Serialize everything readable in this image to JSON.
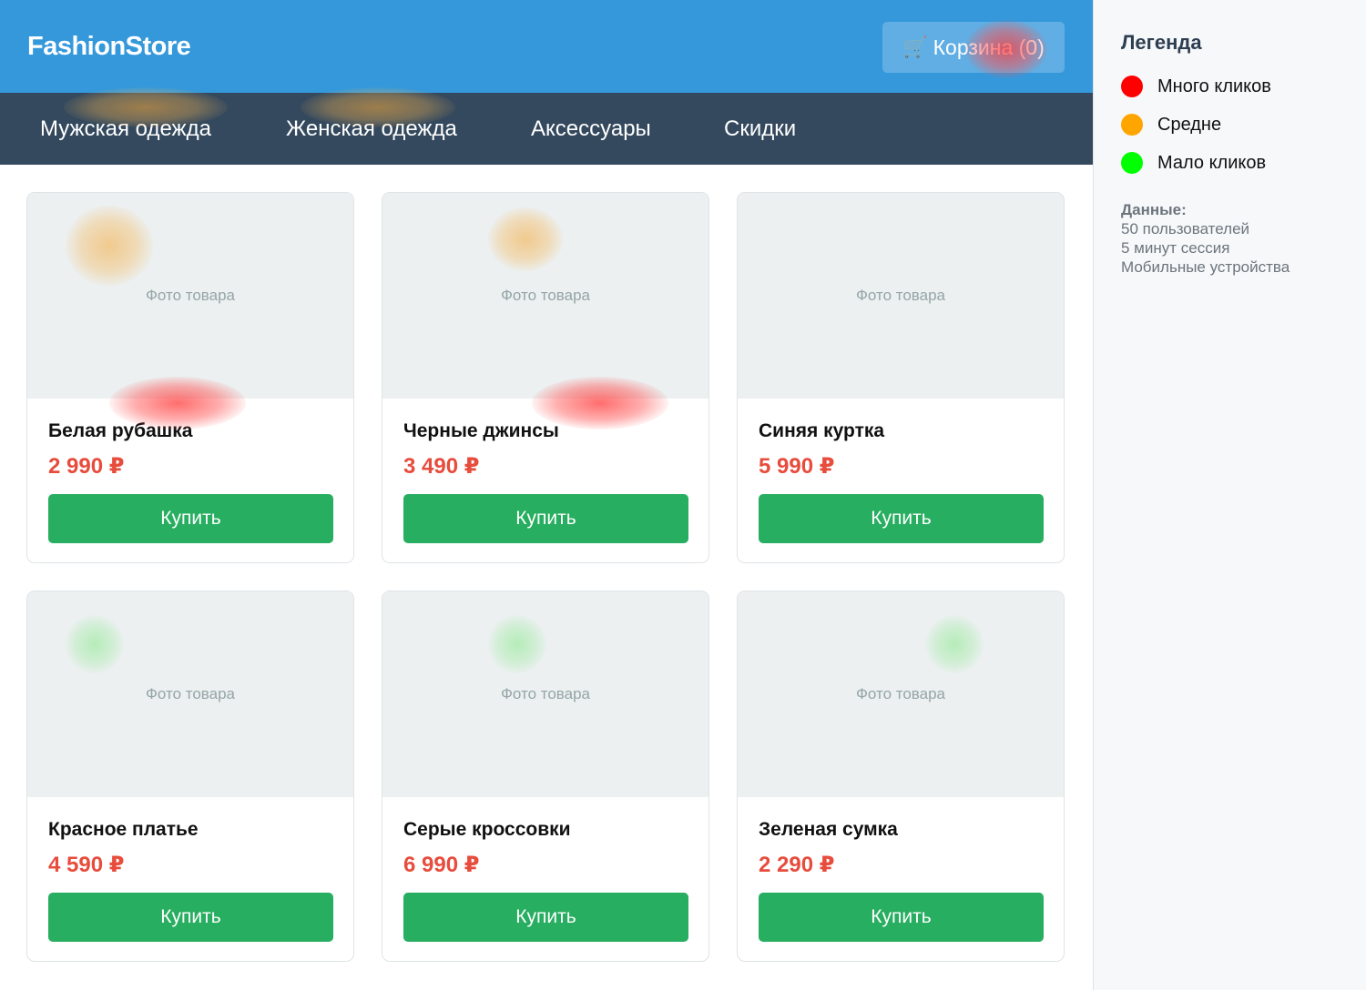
{
  "app": {
    "logo": "FashionStore"
  },
  "header": {
    "cart_icon": "🛒",
    "cart_label": "Корзина (0)"
  },
  "nav": {
    "items": [
      {
        "label": "Мужская одежда"
      },
      {
        "label": "Женская одежда"
      },
      {
        "label": "Аксессуары"
      },
      {
        "label": "Скидки"
      }
    ]
  },
  "products": [
    {
      "photo_placeholder": "Фото товара",
      "name": "Белая рубашка",
      "price": "2 990 ₽",
      "buy_label": "Купить"
    },
    {
      "photo_placeholder": "Фото товара",
      "name": "Черные джинсы",
      "price": "3 490 ₽",
      "buy_label": "Купить"
    },
    {
      "photo_placeholder": "Фото товара",
      "name": "Синяя куртка",
      "price": "5 990 ₽",
      "buy_label": "Купить"
    },
    {
      "photo_placeholder": "Фото товара",
      "name": "Красное платье",
      "price": "4 590 ₽",
      "buy_label": "Купить"
    },
    {
      "photo_placeholder": "Фото товара",
      "name": "Серые кроссовки",
      "price": "6 990 ₽",
      "buy_label": "Купить"
    },
    {
      "photo_placeholder": "Фото товара",
      "name": "Зеленая сумка",
      "price": "2 290 ₽",
      "buy_label": "Купить"
    }
  ],
  "sidebar": {
    "legend_title": "Легенда",
    "legend": [
      {
        "label": "Много кликов",
        "color": "#ff0000"
      },
      {
        "label": "Средне",
        "color": "#ffa500"
      },
      {
        "label": "Мало кликов",
        "color": "#00ff00"
      }
    ],
    "data_title": "Данные:",
    "data_lines": [
      "50 пользователей",
      "5 минут сессия",
      "Мобильные устройства"
    ]
  },
  "colors": {
    "header_bg": "#3498db",
    "nav_bg": "#34495e",
    "price": "#e74c3c",
    "buy_button": "#27ae60"
  }
}
